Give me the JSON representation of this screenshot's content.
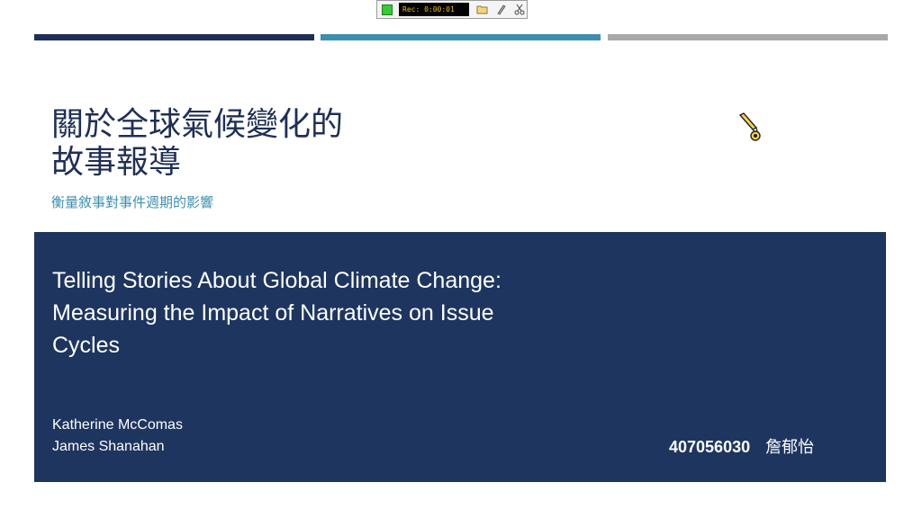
{
  "recorder": {
    "display_text": "Rec: 0:00:01"
  },
  "icons": {
    "folder": "folder-icon",
    "pen": "pen-icon",
    "cut": "scissors-icon"
  },
  "slide": {
    "title_line1": "關於全球氣候變化的",
    "title_line2": "故事報導",
    "subtitle": "衡量敘事對事件週期的影響",
    "english_title_line1": "Telling Stories About Global Climate Change:",
    "english_title_line2": "Measuring the Impact of Narratives on Issue",
    "english_title_line3": "Cycles",
    "authors": [
      "Katherine McComas",
      "James Shanahan"
    ],
    "student_id": "407056030",
    "student_name": "詹郁怡"
  }
}
